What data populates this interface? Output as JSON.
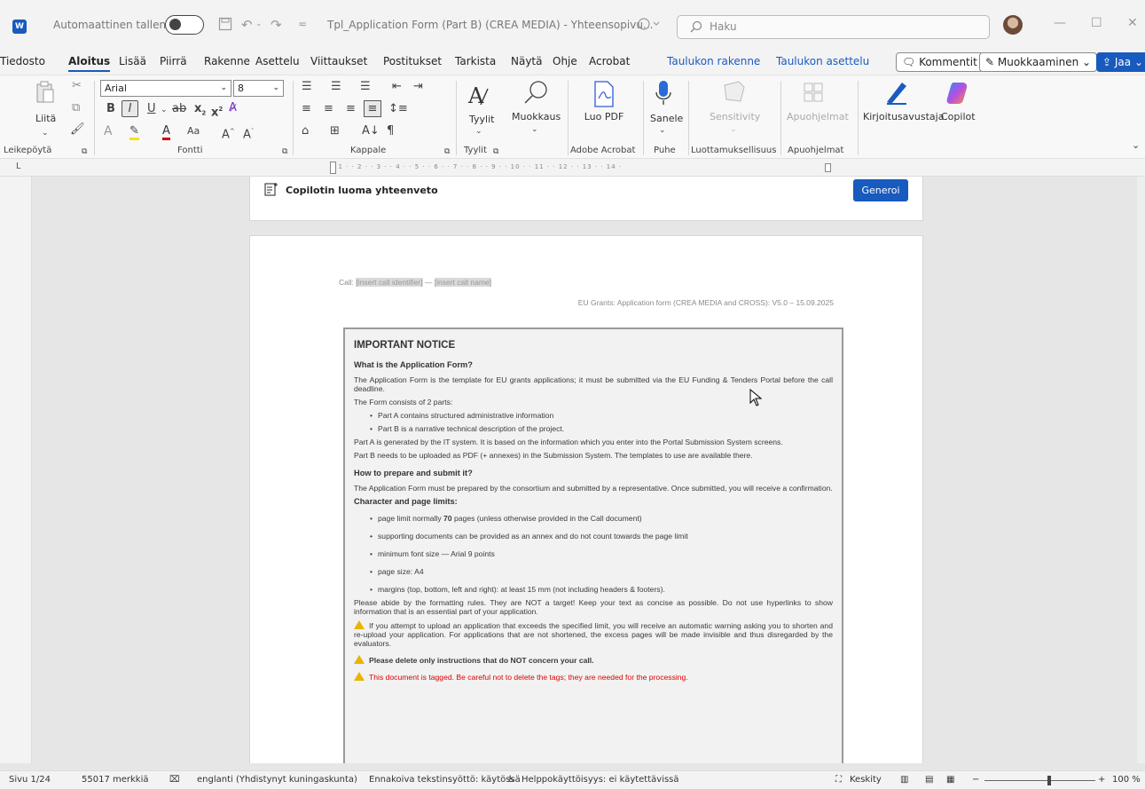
{
  "titlebar": {
    "autosave_label": "Automaattinen tallennus",
    "doc_title": "Tpl_Application Form (Part B) (CREA MEDIA)  -  Yhteensopivu...",
    "search_placeholder": "Haku",
    "app_badge": "W"
  },
  "menu": {
    "tabs": [
      "Tiedosto",
      "Aloitus",
      "Lisää",
      "Piirrä",
      "Rakenne",
      "Asettelu",
      "Viittaukset",
      "Postitukset",
      "Tarkista",
      "Näytä",
      "Ohje",
      "Acrobat",
      "Taulukon rakenne",
      "Taulukon asettelu"
    ],
    "comments": "Kommentit",
    "editing": "Muokkaaminen",
    "share": "Jaa"
  },
  "ribbon": {
    "font_name": "Arial",
    "font_size": "8",
    "paste": "Liitä",
    "styles": "Tyylit",
    "editing": "Muokkaus",
    "create_pdf": "Luo PDF",
    "dictate": "Sanele",
    "sensitivity": "Sensitivity",
    "addins": "Apuohjelmat",
    "writing_assistant": "Kirjoitusavustaja",
    "copilot": "Copilot",
    "groups": {
      "clipboard": "Leikepöytä",
      "font": "Fontti",
      "paragraph": "Kappale",
      "styles": "Tyylit",
      "acrobat": "Adobe Acrobat",
      "voice": "Puhe",
      "sensitivity": "Luottamuksellisuus",
      "addins": "Apuohjelmat"
    }
  },
  "ruler": {
    "text": "· 1 · · 2 · · 3 · · 4 · · 5 · · 6 · · 7 · · 8 · · 9 · · 10 · · 11 · · 12 · · 13 · · 14 ·"
  },
  "copilot": {
    "title": "Copilotin luoma yhteenveto",
    "button": "Generoi"
  },
  "doc": {
    "call_prefix": "Call: ",
    "call_id": "[insert call identifier]",
    "call_sep": " — ",
    "call_name": "[insert call name]",
    "version": "EU Grants: Application form (CREA MEDIA and CROSS): V5.0 – 15.09.2025",
    "notice": {
      "title": "IMPORTANT NOTICE",
      "h1": "What is the Application Form?",
      "p1": "The Application Form is the template for EU grants applications; it must be submitted via the EU Funding & Tenders Portal before the call deadline.",
      "p2": "The Form consists of 2 parts:",
      "parts": [
        "Part A contains structured administrative information",
        "Part B is a narrative technical description of the project."
      ],
      "p3": "Part A is generated by the IT system. It is based on the information which you enter into the Portal Submission System screens.",
      "p4": "Part B needs to be uploaded as PDF (+ annexes) in the Submission System. The templates to use are available there.",
      "h2": "How to prepare and submit it?",
      "p5": "The Application Form must be prepared by the consortium and submitted by a representative. Once submitted, you will receive a confirmation.",
      "h3": "Character and page limits:",
      "limits_a": "page limit normally ",
      "limits_a_bold": "70",
      "limits_a_end": " pages (unless otherwise provided in the Call document)",
      "limits": [
        "supporting documents can be provided as an annex and do not count towards the page limit",
        "minimum font size — Arial 9 points",
        "page size: A4",
        "margins (top, bottom, left and right): at least 15 mm (not including headers & footers)."
      ],
      "p6": "Please abide by the formatting rules. They are NOT a target! Keep your text as concise as possible. Do not use hyperlinks to show information that is an essential part of your application.",
      "w1": "If you attempt to upload an application that exceeds the specified limit, you will receive an automatic warning asking you to shorten and re-upload your application. For applications that are not shortened, the excess pages will be made invisible and thus disregarded by the evaluators.",
      "w2": "Please delete only instructions that do NOT concern your call.",
      "w3": "This document is tagged. Be careful not to delete the tags; they are needed for the processing."
    }
  },
  "status": {
    "page": "Sivu 1/24",
    "chars": "55017 merkkiä",
    "lang": "englanti (Yhdistynyt kuningaskunta)",
    "predict": "Ennakoiva tekstinsyöttö: käytössä",
    "access": "Helppokäyttöisyys: ei käytettävissä",
    "focus": "Keskity",
    "zoom": "100 %"
  }
}
